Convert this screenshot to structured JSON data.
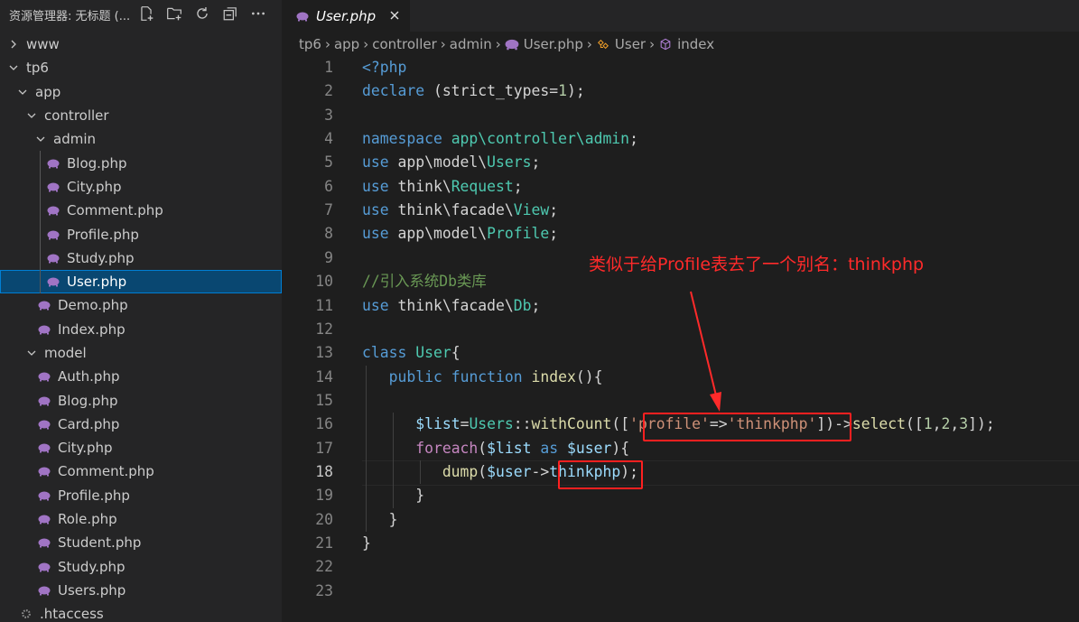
{
  "explorer": {
    "title": "资源管理器: 无标题 (...",
    "actions": [
      "new-file-icon",
      "new-folder-icon",
      "refresh-icon",
      "collapse-all-icon",
      "more-icon"
    ]
  },
  "tree": [
    {
      "label": "www",
      "kind": "folder",
      "open": false,
      "depth": 0
    },
    {
      "label": "tp6",
      "kind": "folder",
      "open": true,
      "depth": 0
    },
    {
      "label": "app",
      "kind": "folder",
      "open": true,
      "depth": 1
    },
    {
      "label": "controller",
      "kind": "folder",
      "open": true,
      "depth": 2
    },
    {
      "label": "admin",
      "kind": "folder",
      "open": true,
      "depth": 3
    },
    {
      "label": "Blog.php",
      "kind": "php",
      "depth": 4
    },
    {
      "label": "City.php",
      "kind": "php",
      "depth": 4
    },
    {
      "label": "Comment.php",
      "kind": "php",
      "depth": 4
    },
    {
      "label": "Profile.php",
      "kind": "php",
      "depth": 4
    },
    {
      "label": "Study.php",
      "kind": "php",
      "depth": 4
    },
    {
      "label": "User.php",
      "kind": "php",
      "depth": 4,
      "selected": true
    },
    {
      "label": "Demo.php",
      "kind": "php",
      "depth": 3
    },
    {
      "label": "Index.php",
      "kind": "php",
      "depth": 3
    },
    {
      "label": "model",
      "kind": "folder",
      "open": true,
      "depth": 2
    },
    {
      "label": "Auth.php",
      "kind": "php",
      "depth": 3
    },
    {
      "label": "Blog.php",
      "kind": "php",
      "depth": 3
    },
    {
      "label": "Card.php",
      "kind": "php",
      "depth": 3
    },
    {
      "label": "City.php",
      "kind": "php",
      "depth": 3
    },
    {
      "label": "Comment.php",
      "kind": "php",
      "depth": 3
    },
    {
      "label": "Profile.php",
      "kind": "php",
      "depth": 3
    },
    {
      "label": "Role.php",
      "kind": "php",
      "depth": 3
    },
    {
      "label": "Student.php",
      "kind": "php",
      "depth": 3
    },
    {
      "label": "Study.php",
      "kind": "php",
      "depth": 3
    },
    {
      "label": "Users.php",
      "kind": "php",
      "depth": 3
    },
    {
      "label": ".htaccess",
      "kind": "gear",
      "depth": 1
    }
  ],
  "tab": {
    "label": "User.php"
  },
  "breadcrumb": [
    "tp6",
    "app",
    "controller",
    "admin",
    "User.php",
    "User",
    "index"
  ],
  "editor": {
    "active_line": 18,
    "lines": [
      [
        [
          "kw",
          "<?php"
        ]
      ],
      [
        [
          "kw",
          "declare"
        ],
        [
          "pl",
          " (strict_types="
        ],
        [
          "nm",
          "1"
        ],
        [
          "pl",
          ");"
        ]
      ],
      [],
      [
        [
          "kw",
          "namespace"
        ],
        [
          "pl",
          " "
        ],
        [
          "ty",
          "app\\controller\\admin"
        ],
        [
          "pl",
          ";"
        ]
      ],
      [
        [
          "kw",
          "use"
        ],
        [
          "pl",
          " app\\model\\"
        ],
        [
          "ty",
          "Users"
        ],
        [
          "pl",
          ";"
        ]
      ],
      [
        [
          "kw",
          "use"
        ],
        [
          "pl",
          " think\\"
        ],
        [
          "ty",
          "Request"
        ],
        [
          "pl",
          ";"
        ]
      ],
      [
        [
          "kw",
          "use"
        ],
        [
          "pl",
          " think\\facade\\"
        ],
        [
          "ty",
          "View"
        ],
        [
          "pl",
          ";"
        ]
      ],
      [
        [
          "kw",
          "use"
        ],
        [
          "pl",
          " app\\model\\"
        ],
        [
          "ty",
          "Profile"
        ],
        [
          "pl",
          ";"
        ]
      ],
      [],
      [
        [
          "cm",
          "//引入系统Db类库"
        ]
      ],
      [
        [
          "kw",
          "use"
        ],
        [
          "pl",
          " think\\facade\\"
        ],
        [
          "ty",
          "Db"
        ],
        [
          "pl",
          ";"
        ]
      ],
      [],
      [
        [
          "kw",
          "class"
        ],
        [
          "pl",
          " "
        ],
        [
          "ty",
          "User"
        ],
        [
          "pl",
          "{"
        ]
      ],
      [
        [
          "pl",
          "   "
        ],
        [
          "kw",
          "public"
        ],
        [
          "pl",
          " "
        ],
        [
          "kw",
          "function"
        ],
        [
          "pl",
          " "
        ],
        [
          "fn",
          "index"
        ],
        [
          "pl",
          "(){"
        ]
      ],
      [],
      [
        [
          "pl",
          "      "
        ],
        [
          "vr",
          "$list"
        ],
        [
          "pl",
          "="
        ],
        [
          "ty",
          "Users"
        ],
        [
          "pl",
          "::"
        ],
        [
          "fn",
          "withCount"
        ],
        [
          "pl",
          "(["
        ],
        [
          "st",
          "'profile'"
        ],
        [
          "pl",
          "=>"
        ],
        [
          "st",
          "'thinkphp'"
        ],
        [
          "pl",
          "])->"
        ],
        [
          "fn",
          "select"
        ],
        [
          "pl",
          "(["
        ],
        [
          "nm",
          "1"
        ],
        [
          "pl",
          ","
        ],
        [
          "nm",
          "2"
        ],
        [
          "pl",
          ","
        ],
        [
          "nm",
          "3"
        ],
        [
          "pl",
          "]);"
        ]
      ],
      [
        [
          "pl",
          "      "
        ],
        [
          "kc",
          "foreach"
        ],
        [
          "pl",
          "("
        ],
        [
          "vr",
          "$list"
        ],
        [
          "pl",
          " "
        ],
        [
          "kw",
          "as"
        ],
        [
          "pl",
          " "
        ],
        [
          "vr",
          "$user"
        ],
        [
          "pl",
          "){"
        ]
      ],
      [
        [
          "pl",
          "         "
        ],
        [
          "fn",
          "dump"
        ],
        [
          "pl",
          "("
        ],
        [
          "vr",
          "$user"
        ],
        [
          "pl",
          "->"
        ],
        [
          "vr",
          "thinkphp"
        ],
        [
          "pl",
          ");"
        ]
      ],
      [
        [
          "pl",
          "      }"
        ]
      ],
      [
        [
          "pl",
          "   }"
        ]
      ],
      [
        [
          "pl",
          "}"
        ]
      ],
      [],
      []
    ]
  },
  "annotation": {
    "text": "类似于给Profile表去了一个别名：thinkphp"
  },
  "colors": {
    "accent": "#007fd4",
    "selection": "#094771",
    "annotation": "#ff2a2a",
    "php_icon": "#a074c4"
  }
}
